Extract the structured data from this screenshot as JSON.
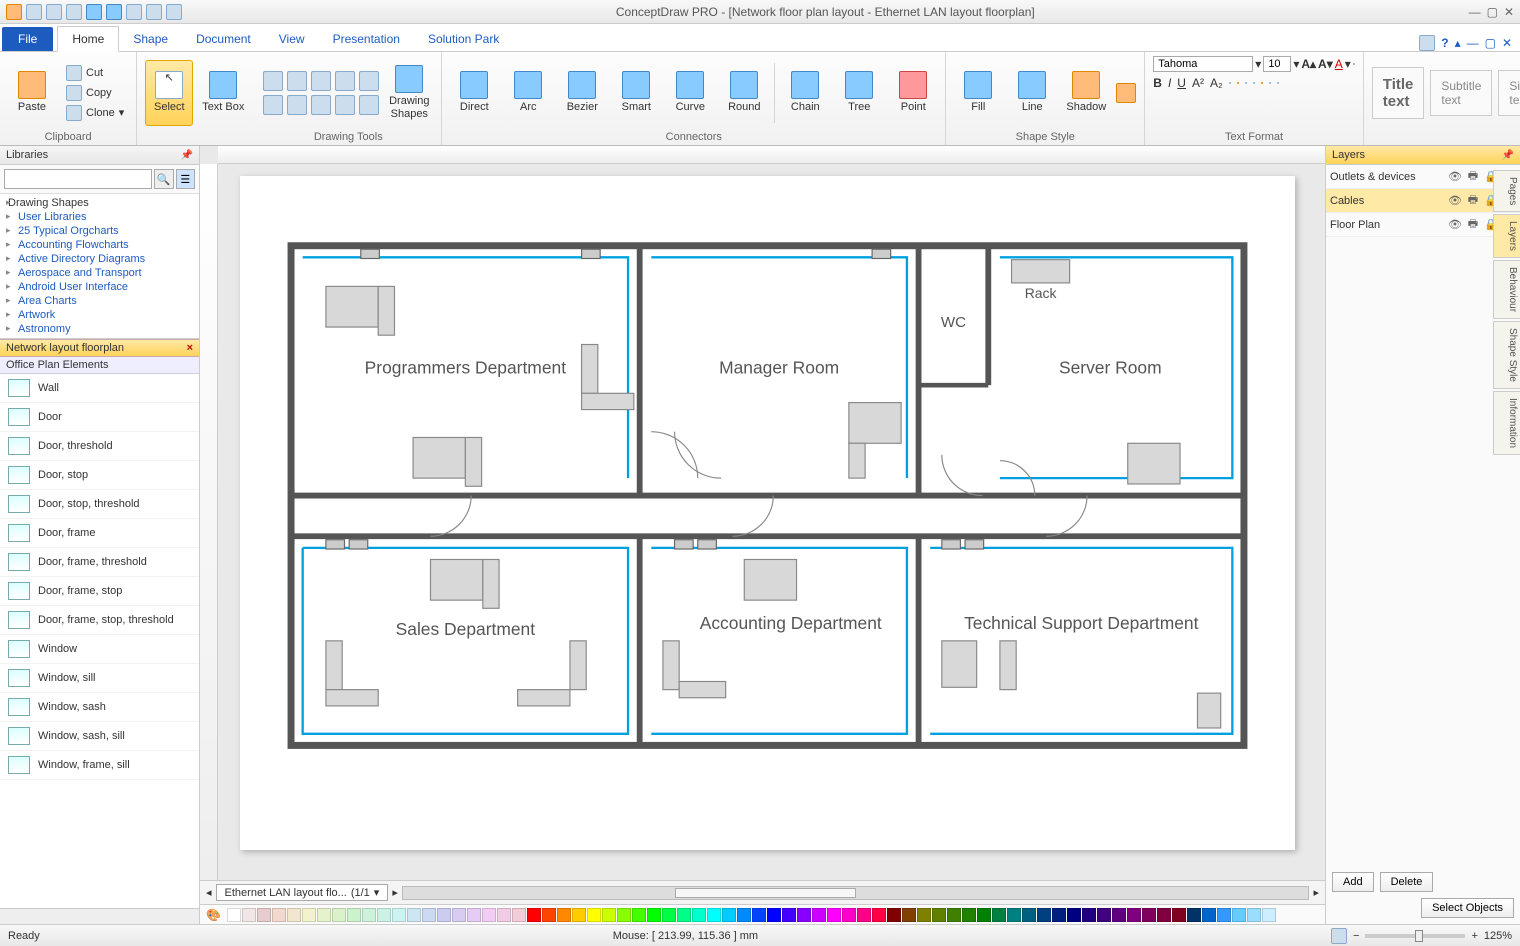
{
  "app": {
    "title": "ConceptDraw PRO - [Network floor plan layout - Ethernet LAN layout floorplan]"
  },
  "ribbon": {
    "file": "File",
    "tabs": [
      "Home",
      "Shape",
      "Document",
      "View",
      "Presentation",
      "Solution Park"
    ],
    "active_tab": "Home",
    "clipboard": {
      "paste": "Paste",
      "cut": "Cut",
      "copy": "Copy",
      "clone": "Clone",
      "label": "Clipboard"
    },
    "select": "Select",
    "textbox": "Text Box",
    "drawing_shapes": "Drawing Shapes",
    "drawing_tools_label": "Drawing Tools",
    "connectors": {
      "direct": "Direct",
      "arc": "Arc",
      "bezier": "Bezier",
      "smart": "Smart",
      "curve": "Curve",
      "round": "Round",
      "chain": "Chain",
      "tree": "Tree",
      "point": "Point",
      "label": "Connectors"
    },
    "shape_style": {
      "fill": "Fill",
      "line": "Line",
      "shadow": "Shadow",
      "label": "Shape Style"
    },
    "text_format": {
      "font_name": "Tahoma",
      "font_size": "10",
      "label": "Text Format",
      "title_btn": "Title text",
      "subtitle_btn": "Subtitle text",
      "simple_btn": "Simple text"
    }
  },
  "libraries_panel": {
    "title": "Libraries",
    "search_placeholder": "",
    "root": "Drawing Shapes",
    "tree": [
      "User Libraries",
      "25 Typical Orgcharts",
      "Accounting Flowcharts",
      "Active Directory Diagrams",
      "Aerospace and Transport",
      "Android User Interface",
      "Area Charts",
      "Artwork",
      "Astronomy"
    ],
    "open_lib": "Network layout floorplan",
    "sub_lib": "Office Plan Elements",
    "shapes": [
      "Wall",
      "Door",
      "Door, threshold",
      "Door, stop",
      "Door, stop, threshold",
      "Door, frame",
      "Door, frame, threshold",
      "Door, frame, stop",
      "Door, frame, stop, threshold",
      "Window",
      "Window, sill",
      "Window, sash",
      "Window, sash, sill",
      "Window, frame, sill"
    ]
  },
  "floorplan": {
    "rooms": {
      "programmers": "Programmers Department",
      "manager": "Manager Room",
      "wc": "WC",
      "server": "Server Room",
      "rack": "Rack",
      "sales": "Sales Department",
      "accounting": "Accounting Department",
      "techsupport": "Technical Support Department"
    }
  },
  "page_tabs": {
    "tab": "Ethernet LAN layout flo...",
    "pages": "(1/1"
  },
  "layers_panel": {
    "title": "Layers",
    "rows": [
      {
        "name": "Outlets & devices",
        "color": "#ff0000"
      },
      {
        "name": "Cables",
        "color": "#ff9900"
      },
      {
        "name": "Floor Plan",
        "color": "#ffcc33"
      }
    ],
    "selected": 1,
    "add": "Add",
    "delete": "Delete",
    "select_objects": "Select Objects"
  },
  "side_tabs": [
    "Pages",
    "Layers",
    "Behaviour",
    "Shape Style",
    "Information"
  ],
  "statusbar": {
    "ready": "Ready",
    "mouse": "Mouse: [ 213.99, 115.36 ] mm",
    "zoom": "125%"
  },
  "palette": [
    "#ffffff",
    "#f2e6e6",
    "#e6cccc",
    "#f2d9cc",
    "#f2e6cc",
    "#f2f2cc",
    "#e6f2cc",
    "#d9f2cc",
    "#ccf2cc",
    "#ccf2d9",
    "#ccf2e6",
    "#ccf2f2",
    "#cce6f2",
    "#ccd9f2",
    "#ccccf2",
    "#d9ccf2",
    "#e6ccf2",
    "#f2ccf2",
    "#f2cce6",
    "#f2ccd9",
    "#ff0000",
    "#ff4400",
    "#ff8800",
    "#ffcc00",
    "#ffff00",
    "#ccff00",
    "#88ff00",
    "#44ff00",
    "#00ff00",
    "#00ff44",
    "#00ff88",
    "#00ffcc",
    "#00ffff",
    "#00ccff",
    "#0088ff",
    "#0044ff",
    "#0000ff",
    "#4400ff",
    "#8800ff",
    "#cc00ff",
    "#ff00ff",
    "#ff00cc",
    "#ff0088",
    "#ff0044",
    "#800000",
    "#804000",
    "#808000",
    "#608000",
    "#408000",
    "#208000",
    "#008000",
    "#008040",
    "#008080",
    "#006080",
    "#004080",
    "#002080",
    "#000080",
    "#200080",
    "#400080",
    "#600080",
    "#800080",
    "#800060",
    "#800040",
    "#800020",
    "#003366",
    "#0066cc",
    "#3399ff",
    "#66ccff",
    "#99ddff",
    "#cceeff"
  ]
}
